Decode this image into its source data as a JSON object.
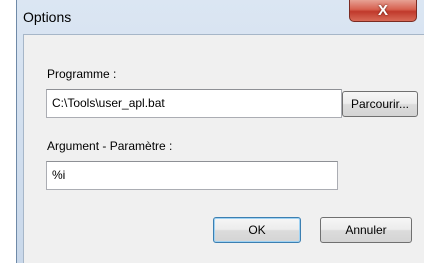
{
  "window": {
    "title": "Options",
    "close_glyph": "X"
  },
  "form": {
    "program_label": "Programme :",
    "program_value": "C:\\Tools\\user_apl.bat",
    "browse_label": "Parcourir...",
    "argument_label": "Argument - Paramètre :",
    "argument_value": "%i"
  },
  "actions": {
    "ok_label": "OK",
    "cancel_label": "Annuler"
  }
}
